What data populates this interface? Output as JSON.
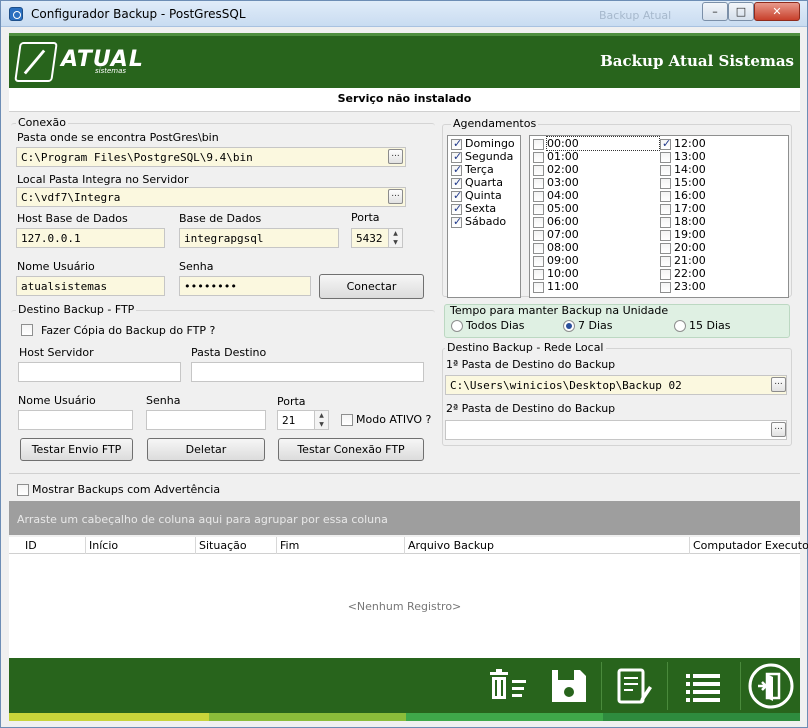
{
  "window": {
    "title": "Configurador Backup - PostGresSQL",
    "ghost_title": "Backup Atual",
    "min_label": "–",
    "max_label": "□",
    "close_label": "✕"
  },
  "header": {
    "logo_text": "ATUAL",
    "logo_sub": "sistemas",
    "brand": "Backup Atual Sistemas"
  },
  "status": "Serviço não instalado",
  "conexao": {
    "group": "Conexão",
    "pg_label": "Pasta onde se encontra PostGres\\bin",
    "pg_value": "C:\\Program Files\\PostgreSQL\\9.4\\bin",
    "local_label": "Local Pasta Integra no Servidor",
    "local_value": "C:\\vdf7\\Integra",
    "host_label": "Host Base de Dados",
    "host_value": "127.0.0.1",
    "db_label": "Base de Dados",
    "db_value": "integrapgsql",
    "port_label": "Porta",
    "port_value": "5432",
    "user_label": "Nome Usuário",
    "user_value": "atualsistemas",
    "pass_label": "Senha",
    "pass_value": "••••••••",
    "connect": "Conectar",
    "browse": "..."
  },
  "ftp": {
    "group": "Destino Backup - FTP",
    "copy_label": "Fazer Cópia do Backup do FTP ?",
    "host_label": "Host Servidor",
    "dest_label": "Pasta Destino",
    "user_label": "Nome Usuário",
    "pass_label": "Senha",
    "port_label": "Porta",
    "port_value": "21",
    "active_label": "Modo ATIVO ?",
    "test_send": "Testar Envio FTP",
    "delete": "Deletar",
    "test_conn": "Testar Conexão FTP"
  },
  "agendamentos": {
    "group": "Agendamentos",
    "days": [
      {
        "label": "Domingo",
        "checked": true
      },
      {
        "label": "Segunda",
        "checked": true
      },
      {
        "label": "Terça",
        "checked": true
      },
      {
        "label": "Quarta",
        "checked": true
      },
      {
        "label": "Quinta",
        "checked": true
      },
      {
        "label": "Sexta",
        "checked": true
      },
      {
        "label": "Sábado",
        "checked": true
      }
    ],
    "hours_am": [
      "00:00",
      "01:00",
      "02:00",
      "03:00",
      "04:00",
      "05:00",
      "06:00",
      "07:00",
      "08:00",
      "09:00",
      "10:00",
      "11:00"
    ],
    "hours_pm": [
      "12:00",
      "13:00",
      "14:00",
      "15:00",
      "16:00",
      "17:00",
      "18:00",
      "19:00",
      "20:00",
      "21:00",
      "22:00",
      "23:00"
    ],
    "checked_hours": [
      "12:00"
    ]
  },
  "retencao": {
    "group": "Tempo para manter Backup na Unidade",
    "options": [
      "Todos Dias",
      "7 Dias",
      "15 Dias"
    ],
    "selected": "7 Dias"
  },
  "rede": {
    "group": "Destino Backup - Rede Local",
    "first_label": "1ª Pasta de Destino do Backup",
    "first_value": "C:\\Users\\winicios\\Desktop\\Backup 02",
    "second_label": "2ª Pasta de Destino do Backup",
    "second_value": ""
  },
  "warnings_label": "Mostrar Backups com Advertência",
  "grid": {
    "group_hint": "Arraste um cabeçalho de coluna aqui para agrupar por essa coluna",
    "columns": [
      "ID",
      "Início",
      "Situação",
      "Fim",
      "Arquivo Backup",
      "Computador Executor"
    ],
    "empty": "<Nenhum Registro>"
  },
  "footer": {
    "icons": [
      "trash-list-icon",
      "save-icon",
      "edit-document-icon",
      "list-icon",
      "exit-door-icon"
    ],
    "bar_colors": [
      "#c8d43a",
      "#8bbd3a",
      "#3fa84a",
      "#2e8b3e"
    ]
  }
}
